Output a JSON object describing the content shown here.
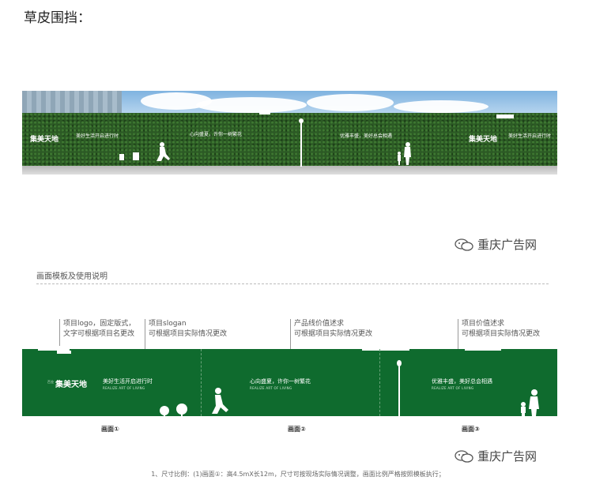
{
  "heading": "草皮围挡：",
  "photo": {
    "logo": "集美天地",
    "slogans": [
      "美好生活开启进行时",
      "心向盛夏，许你一树繁花",
      "优雅丰盛，美好总会相遇",
      "美好生活开启进行时"
    ]
  },
  "watermark": "重庆广告网",
  "spec": {
    "title": "画面模板及使用说明",
    "callouts": [
      {
        "lines": [
          "项目logo，固定版式，",
          "文字可根据项目名更改"
        ]
      },
      {
        "lines": [
          "项目slogan",
          "可根据项目实际情况更改"
        ]
      },
      {
        "lines": [
          "产品线价值述求",
          "可根据项目实际情况更改"
        ]
      },
      {
        "lines": [
          "项目价值述求",
          "可根据项目实际情况更改"
        ]
      }
    ],
    "board": {
      "logo": "集美天地",
      "logo_prefix": "百业",
      "subtitle": "REALIZE ART OF LIVING",
      "texts": [
        "美好生活开启进行时",
        "心向盛夏，许你一树繁花",
        "优雅丰盛，美好总会相遇"
      ]
    },
    "panel_labels": [
      "画面①",
      "画面②",
      "画面③"
    ]
  },
  "note": "1、尺寸比例：(1)画面①：高4.5mX长12m，尺寸可按现场实际情况调整，画面比例严格按照模板执行；"
}
